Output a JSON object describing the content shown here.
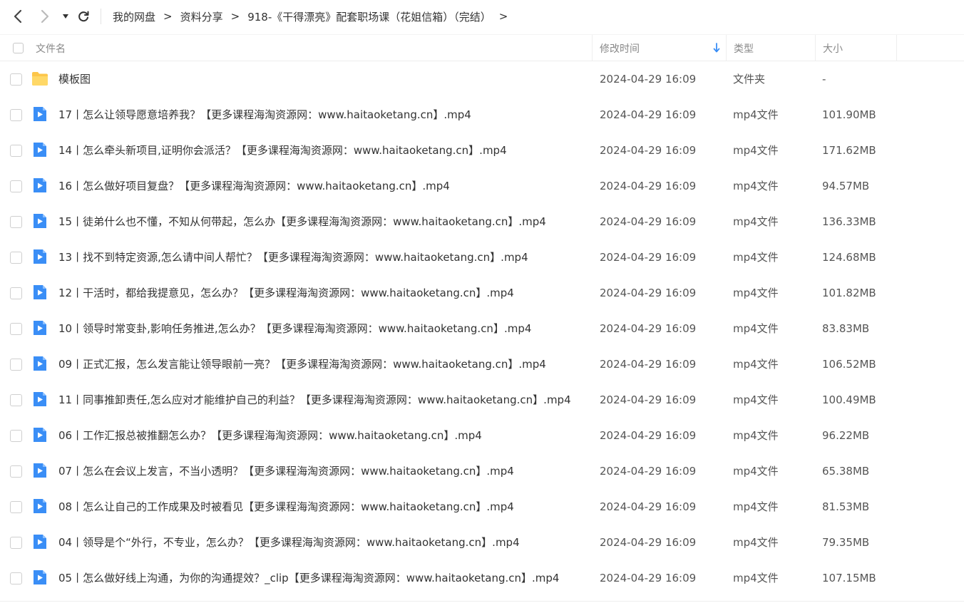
{
  "breadcrumb": {
    "items": [
      "我的网盘",
      "资料分享",
      "918-《干得漂亮》配套职场课（花姐信箱）（完结）"
    ],
    "separator": ">"
  },
  "header": {
    "name": "文件名",
    "modified": "修改时间",
    "type": "类型",
    "size": "大小"
  },
  "colors": {
    "folder": "#fdc64a",
    "video": "#3a8ef6",
    "sort_arrow": "#3a8ef6"
  },
  "files": [
    {
      "name": "模板图",
      "date": "2024-04-29 16:09",
      "type": "文件夹",
      "size": "-",
      "kind": "folder"
    },
    {
      "name": "17丨怎么让领导愿意培养我？【更多课程海淘资源网：www.haitaoketang.cn】.mp4",
      "date": "2024-04-29 16:09",
      "type": "mp4文件",
      "size": "101.90MB",
      "kind": "video"
    },
    {
      "name": "14丨怎么牵头新项目,证明你会派活？【更多课程海淘资源网：www.haitaoketang.cn】.mp4",
      "date": "2024-04-29 16:09",
      "type": "mp4文件",
      "size": "171.62MB",
      "kind": "video"
    },
    {
      "name": "16丨怎么做好项目复盘？【更多课程海淘资源网：www.haitaoketang.cn】.mp4",
      "date": "2024-04-29 16:09",
      "type": "mp4文件",
      "size": "94.57MB",
      "kind": "video"
    },
    {
      "name": "15丨徒弟什么也不懂，不知从何带起，怎么办【更多课程海淘资源网：www.haitaoketang.cn】.mp4",
      "date": "2024-04-29 16:09",
      "type": "mp4文件",
      "size": "136.33MB",
      "kind": "video"
    },
    {
      "name": "13丨找不到特定资源,怎么请中间人帮忙？【更多课程海淘资源网：www.haitaoketang.cn】.mp4",
      "date": "2024-04-29 16:09",
      "type": "mp4文件",
      "size": "124.68MB",
      "kind": "video"
    },
    {
      "name": "12丨干活时，都给我提意见，怎么办？【更多课程海淘资源网：www.haitaoketang.cn】.mp4",
      "date": "2024-04-29 16:09",
      "type": "mp4文件",
      "size": "101.82MB",
      "kind": "video"
    },
    {
      "name": "10丨领导时常变卦,影响任务推进,怎么办？【更多课程海淘资源网：www.haitaoketang.cn】.mp4",
      "date": "2024-04-29 16:09",
      "type": "mp4文件",
      "size": "83.83MB",
      "kind": "video"
    },
    {
      "name": "09丨正式汇报，怎么发言能让领导眼前一亮？【更多课程海淘资源网：www.haitaoketang.cn】.mp4",
      "date": "2024-04-29 16:09",
      "type": "mp4文件",
      "size": "106.52MB",
      "kind": "video"
    },
    {
      "name": "11丨同事推卸责任,怎么应对才能维护自己的利益？【更多课程海淘资源网：www.haitaoketang.cn】.mp4",
      "date": "2024-04-29 16:09",
      "type": "mp4文件",
      "size": "100.49MB",
      "kind": "video"
    },
    {
      "name": "06丨工作汇报总被推翻怎么办？【更多课程海淘资源网：www.haitaoketang.cn】.mp4",
      "date": "2024-04-29 16:09",
      "type": "mp4文件",
      "size": "96.22MB",
      "kind": "video"
    },
    {
      "name": "07丨怎么在会议上发言，不当小透明？【更多课程海淘资源网：www.haitaoketang.cn】.mp4",
      "date": "2024-04-29 16:09",
      "type": "mp4文件",
      "size": "65.38MB",
      "kind": "video"
    },
    {
      "name": "08丨怎么让自己的工作成果及时被看见【更多课程海淘资源网：www.haitaoketang.cn】.mp4",
      "date": "2024-04-29 16:09",
      "type": "mp4文件",
      "size": "81.53MB",
      "kind": "video"
    },
    {
      "name": "04丨领导是个“外行，不专业，怎么办？【更多课程海淘资源网：www.haitaoketang.cn】.mp4",
      "date": "2024-04-29 16:09",
      "type": "mp4文件",
      "size": "79.35MB",
      "kind": "video"
    },
    {
      "name": "05丨怎么做好线上沟通，为你的沟通提效？_clip【更多课程海淘资源网：www.haitaoketang.cn】.mp4",
      "date": "2024-04-29 16:09",
      "type": "mp4文件",
      "size": "107.15MB",
      "kind": "video"
    }
  ]
}
